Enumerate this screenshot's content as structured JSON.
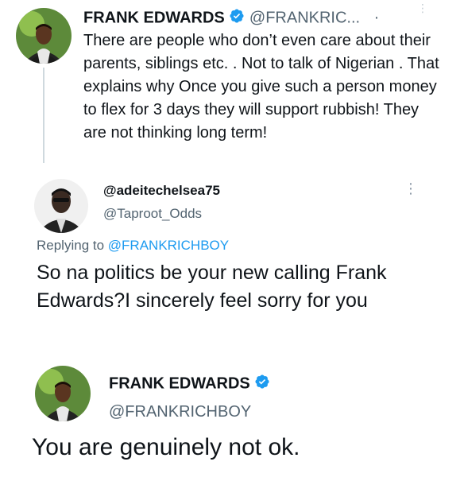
{
  "tweet1": {
    "name": "FRANK EDWARDS",
    "handle": "@FRANKRIC...",
    "separator": "·",
    "text": "There are people who don’t even care about their parents, siblings etc. .  Not to talk of Nigerian . That explains why Once you give such a person money to flex for 3 days they will support rubbish!  They are not thinking long term!"
  },
  "reply": {
    "name": "@adeitechelsea75",
    "handle": "@Taproot_Odds",
    "replying_prefix": "Replying to ",
    "replying_to": "@FRANKRICHBOY",
    "text": "So na politics be your new calling Frank Edwards?I sincerely feel sorry for you"
  },
  "tweet2": {
    "name": "FRANK EDWARDS",
    "handle": "@FRANKRICHBOY",
    "text": "You are genuinely not ok."
  },
  "colors": {
    "verified": "#1d9bf0",
    "link": "#1d9bf0",
    "muted": "#536471"
  }
}
